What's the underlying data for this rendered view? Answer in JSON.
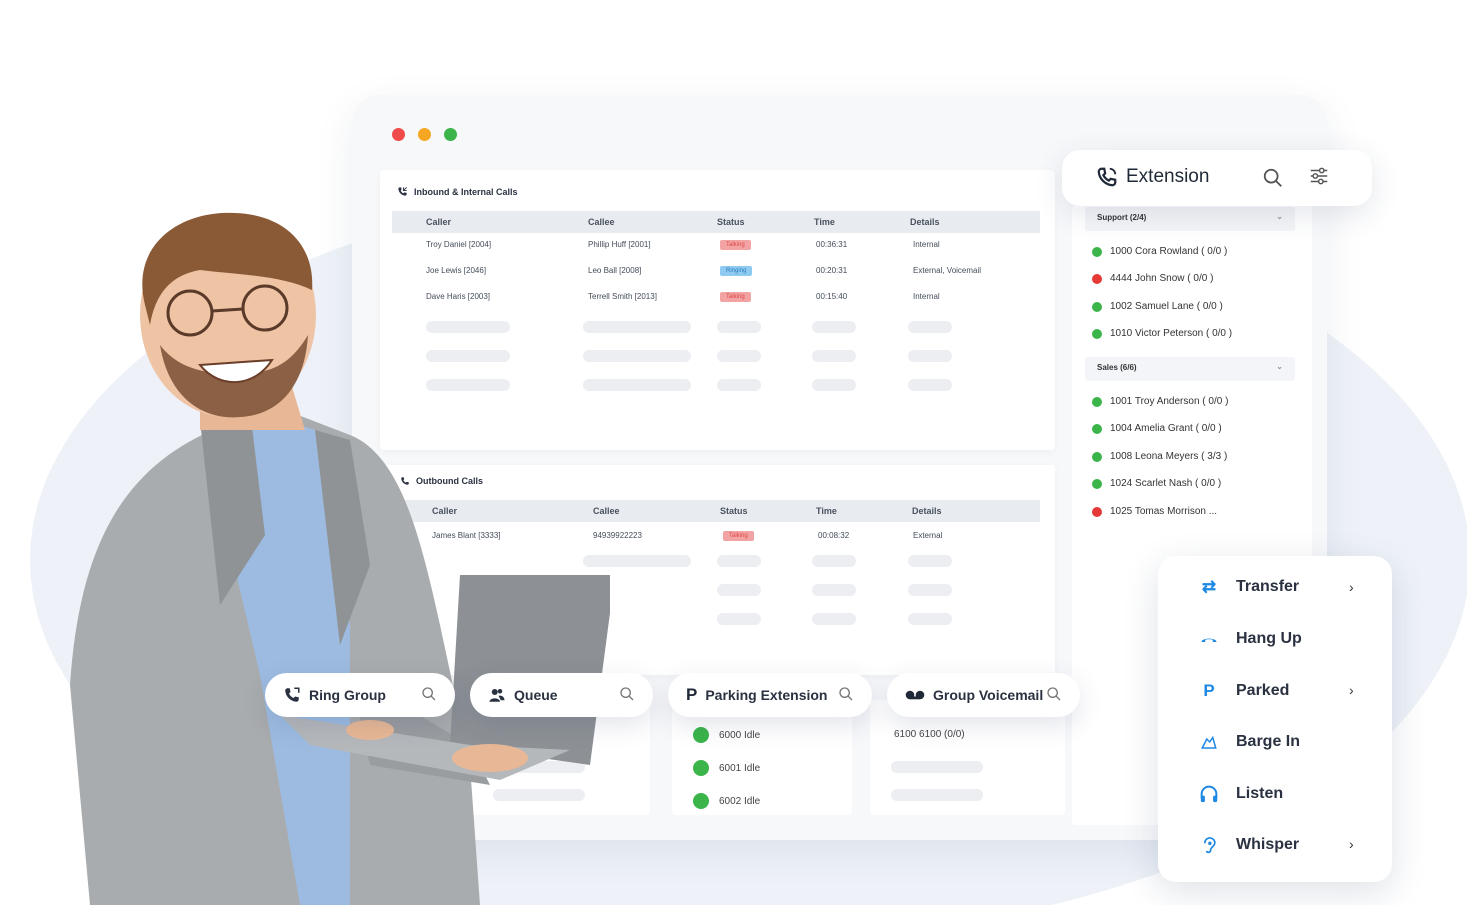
{
  "colors": {
    "accent": "#1e88e5",
    "online": "#3bb54a",
    "busy": "#e53935",
    "talking": "#f2a3a3",
    "ringing": "#8fcbf0"
  },
  "inbound": {
    "title": "Inbound & Internal Calls",
    "headers": [
      "Caller",
      "Callee",
      "Status",
      "Time",
      "Details"
    ],
    "rows": [
      {
        "caller": "Troy Daniel [2004]",
        "callee": "Phillip Huff [2001]",
        "status": "Talking",
        "time": "00:36:31",
        "details": "Internal"
      },
      {
        "caller": "Joe Lewis [2046]",
        "callee": "Leo Ball [2008]",
        "status": "Ringing",
        "time": "00:20:31",
        "details": "External, Voicemail"
      },
      {
        "caller": "Dave Haris [2003]",
        "callee": "Terrell Smith [2013]",
        "status": "Talking",
        "time": "00:15:40",
        "details": "Internal"
      }
    ]
  },
  "outbound": {
    "title": "Outbound Calls",
    "headers": [
      "Caller",
      "Callee",
      "Status",
      "Time",
      "Details"
    ],
    "rows": [
      {
        "caller": "James Blant [3333]",
        "callee": "94939922223",
        "status": "Talking",
        "time": "00:08:32",
        "details": "External"
      }
    ]
  },
  "extension": {
    "title": "Extension",
    "groups": [
      {
        "label": "Support (2/4)",
        "items": [
          {
            "text": "1000 Cora Rowland ( 0/0 )",
            "state": "online"
          },
          {
            "text": "4444 John Snow ( 0/0 )",
            "state": "busy"
          },
          {
            "text": "1002 Samuel Lane ( 0/0 )",
            "state": "online"
          },
          {
            "text": "1010 Victor Peterson ( 0/0 )",
            "state": "online"
          }
        ]
      },
      {
        "label": "Sales (6/6)",
        "items": [
          {
            "text": "1001 Troy Anderson ( 0/0 )",
            "state": "online"
          },
          {
            "text": "1004 Amelia Grant ( 0/0 )",
            "state": "online"
          },
          {
            "text": "1008 Leona Meyers ( 3/3 )",
            "state": "online"
          },
          {
            "text": "1024 Scarlet Nash ( 0/0 )",
            "state": "online"
          },
          {
            "text": "1025 Tomas Morrison ...",
            "state": "busy"
          }
        ]
      }
    ]
  },
  "pills": {
    "ring_group": "Ring Group",
    "queue": "Queue",
    "parking": "Parking Extension",
    "voicemail": "Group Voicemail"
  },
  "parking_rows": [
    "6000 Idle",
    "6001 Idle",
    "6002 Idle"
  ],
  "voicemail_row": "6100 6100 (0/0)",
  "actions": [
    {
      "label": "Transfer",
      "icon": "transfer-icon",
      "chevron": true
    },
    {
      "label": "Hang Up",
      "icon": "hang-up-icon",
      "chevron": false
    },
    {
      "label": "Parked",
      "icon": "parked-icon",
      "chevron": true
    },
    {
      "label": "Barge In",
      "icon": "barge-in-icon",
      "chevron": false
    },
    {
      "label": "Listen",
      "icon": "headphones-icon",
      "chevron": false
    },
    {
      "label": "Whisper",
      "icon": "whisper-icon",
      "chevron": true
    }
  ]
}
